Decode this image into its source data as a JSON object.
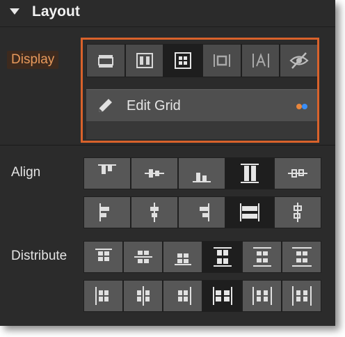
{
  "header": {
    "title": "Layout"
  },
  "display": {
    "label": "Display",
    "options": [
      {
        "icon": "block-icon",
        "active": false
      },
      {
        "icon": "flex-icon",
        "active": false
      },
      {
        "icon": "grid-icon",
        "active": true
      },
      {
        "icon": "inline-block-icon",
        "active": false
      },
      {
        "icon": "inline-text-icon",
        "active": false
      },
      {
        "icon": "hidden-icon",
        "active": false
      }
    ],
    "edit_grid_label": "Edit Grid",
    "accent_colors": [
      "#e8863c",
      "#3a8ef6"
    ]
  },
  "align": {
    "label": "Align",
    "row1": [
      {
        "icon": "align-top-icon",
        "active": false
      },
      {
        "icon": "align-center-vertical-icon",
        "active": false
      },
      {
        "icon": "align-bottom-icon",
        "active": false
      },
      {
        "icon": "align-stretch-vertical-icon",
        "active": true
      },
      {
        "icon": "align-baseline-icon",
        "active": false
      }
    ],
    "row2": [
      {
        "icon": "align-left-icon",
        "active": false
      },
      {
        "icon": "align-center-horizontal-icon",
        "active": false
      },
      {
        "icon": "align-right-icon",
        "active": false
      },
      {
        "icon": "align-stretch-horizontal-icon",
        "active": true
      },
      {
        "icon": "align-baseline-horizontal-icon",
        "active": false
      }
    ]
  },
  "distribute": {
    "label": "Distribute",
    "row1": [
      {
        "icon": "distribute-top-icon",
        "active": false
      },
      {
        "icon": "distribute-center-icon",
        "active": false
      },
      {
        "icon": "distribute-bottom-icon",
        "active": false
      },
      {
        "icon": "distribute-space-between-vertical-icon",
        "active": true
      },
      {
        "icon": "distribute-space-around-vertical-icon",
        "active": false
      },
      {
        "icon": "distribute-space-evenly-vertical-icon",
        "active": false
      }
    ],
    "row2": [
      {
        "icon": "distribute-left-icon",
        "active": false
      },
      {
        "icon": "distribute-center-horizontal-icon",
        "active": false
      },
      {
        "icon": "distribute-right-icon",
        "active": false
      },
      {
        "icon": "distribute-space-between-horizontal-icon",
        "active": true
      },
      {
        "icon": "distribute-space-around-horizontal-icon",
        "active": false
      },
      {
        "icon": "distribute-space-evenly-horizontal-icon",
        "active": false
      }
    ]
  },
  "colors": {
    "highlight": "#d9622b",
    "display_label": "#e89a5c",
    "panel": "#2b2b2b"
  }
}
